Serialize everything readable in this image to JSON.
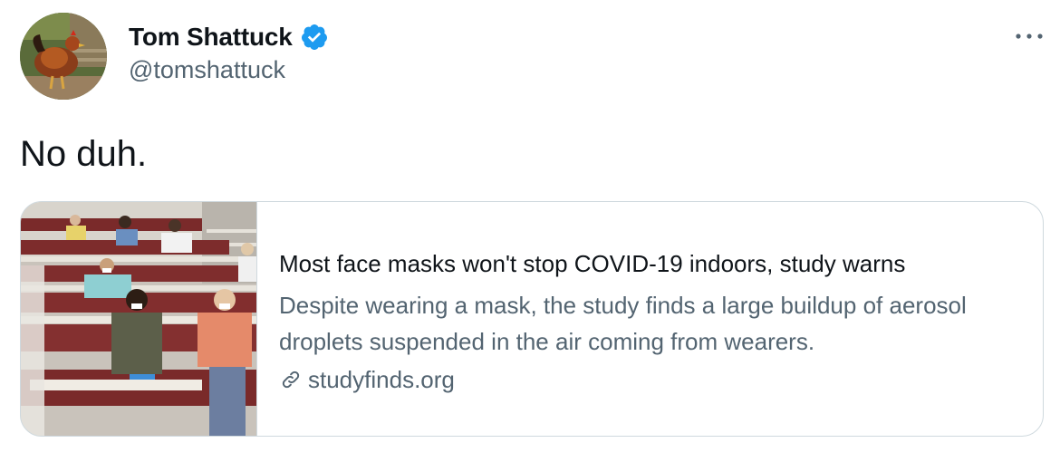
{
  "author": {
    "name": "Tom Shattuck",
    "handle": "@tomshattuck",
    "verified_icon": "verified-badge-icon",
    "avatar_icon": "rooster-avatar"
  },
  "tweet": {
    "text": "No duh."
  },
  "card": {
    "title": "Most face masks won't stop COVID-19 indoors, study warns",
    "description": "Despite wearing a mask, the study finds a large buildup of aerosol droplets suspended in the air coming from wearers.",
    "domain": "studyfinds.org",
    "image_icon": "classroom-photo",
    "link_icon": "link-icon"
  },
  "menu": {
    "icon": "more-horizontal-icon"
  },
  "colors": {
    "text_primary": "#0f1419",
    "text_secondary": "#536471",
    "verified_blue": "#1d9bf0",
    "border": "#cfd9de"
  }
}
